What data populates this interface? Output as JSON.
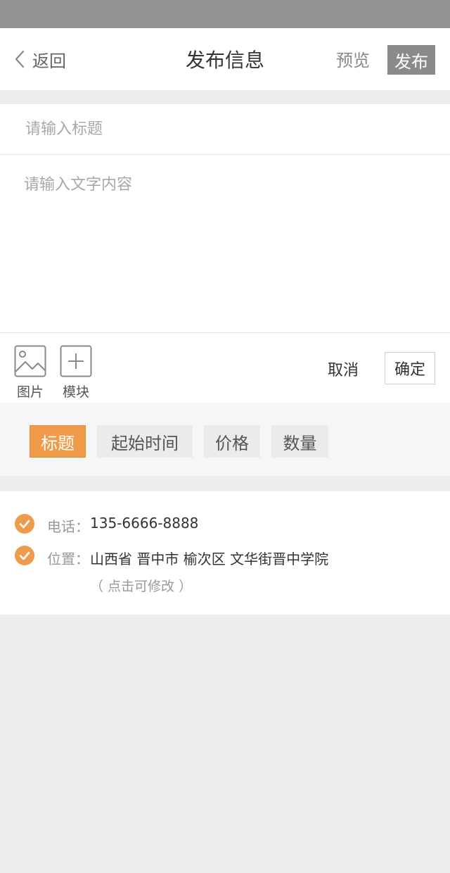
{
  "header": {
    "back_label": "返回",
    "title": "发布信息",
    "preview_label": "预览",
    "publish_label": "发布"
  },
  "editor": {
    "title_placeholder": "请输入标题",
    "content_placeholder": "请输入文字内容"
  },
  "toolbar": {
    "image_label": "图片",
    "module_label": "模块",
    "cancel_label": "取消",
    "confirm_label": "确定",
    "image_icon": "image-icon",
    "module_icon": "plus-icon"
  },
  "tags": {
    "items": [
      "标题",
      "起始时间",
      "价格",
      "数量"
    ],
    "active_index": 0
  },
  "contact": {
    "phone_label": "电话：",
    "phone_value": "135-6666-8888",
    "location_label": "位置：",
    "location_value": "山西省 晋中市 榆次区 文华街晋中学院",
    "edit_hint": "（ 点击可修改 ）",
    "check_icon": "check-circle-icon"
  },
  "colors": {
    "accent": "#f09a4c",
    "status_bar": "#949494",
    "publish_button": "#8a8a8a",
    "page_background": "#ededed"
  }
}
